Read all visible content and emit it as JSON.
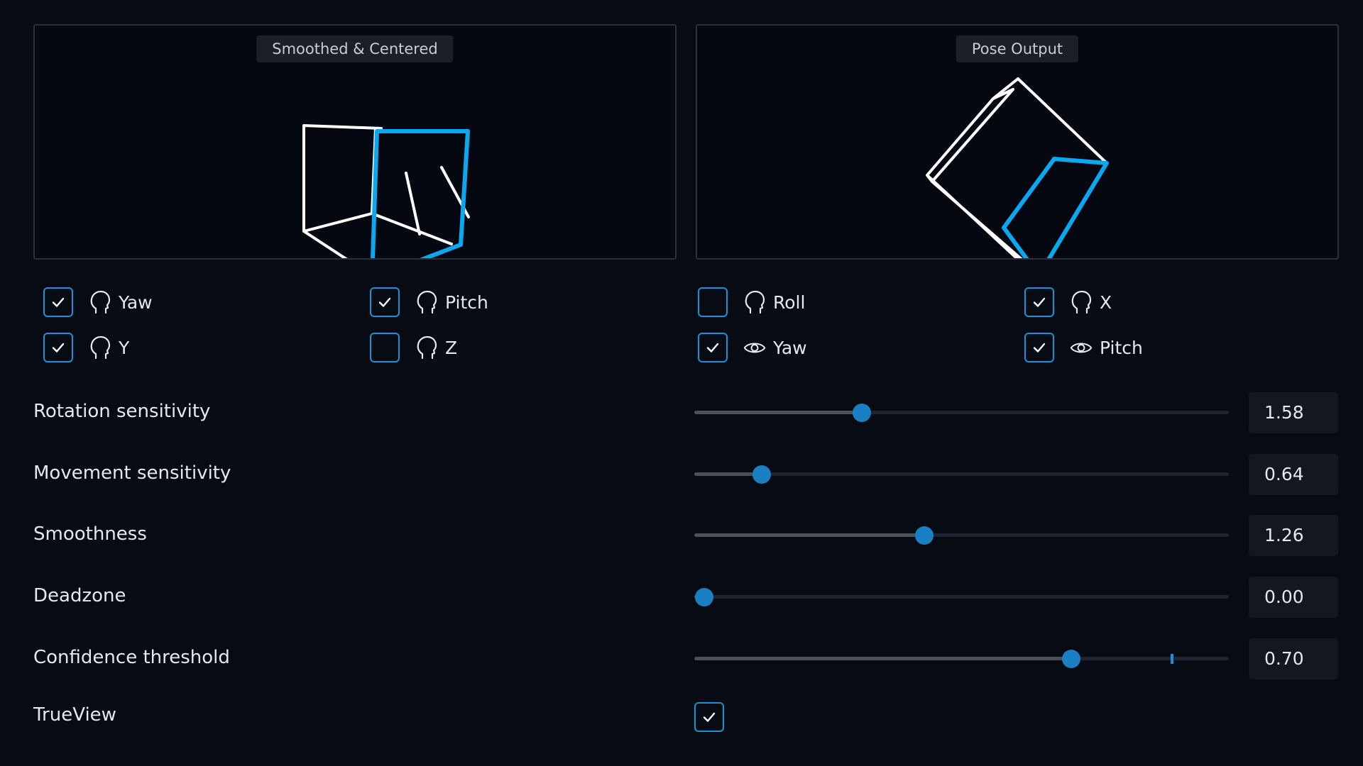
{
  "views": {
    "left_label": "Smoothed & Centered",
    "right_label": "Pose Output"
  },
  "axes": [
    {
      "label": "Yaw",
      "icon": "head-icon",
      "checked": true
    },
    {
      "label": "Pitch",
      "icon": "head-icon",
      "checked": true
    },
    {
      "label": "Roll",
      "icon": "head-icon",
      "checked": false
    },
    {
      "label": "X",
      "icon": "head-icon",
      "checked": true
    },
    {
      "label": "Y",
      "icon": "head-icon",
      "checked": true
    },
    {
      "label": "Z",
      "icon": "head-icon",
      "checked": false
    },
    {
      "label": "Yaw",
      "icon": "eye-icon",
      "checked": true
    },
    {
      "label": "Pitch",
      "icon": "eye-icon",
      "checked": true
    }
  ],
  "settings": [
    {
      "label": "Rotation sensitivity",
      "value": "1.58",
      "fraction": 0.314
    },
    {
      "label": "Movement sensitivity",
      "value": "0.64",
      "fraction": 0.126
    },
    {
      "label": "Smoothness",
      "value": "1.26",
      "fraction": 0.43
    },
    {
      "label": "Deadzone",
      "value": "0.00",
      "fraction": 0.018
    },
    {
      "label": "Confidence threshold",
      "value": "0.70",
      "fraction": 0.705,
      "marker_fraction": 0.894
    }
  ],
  "trueview": {
    "label": "TrueView",
    "checked": true
  },
  "colors": {
    "accent": "#1793d6",
    "cube_highlight": "#0aa8f0",
    "cube_line": "#ffffff"
  }
}
